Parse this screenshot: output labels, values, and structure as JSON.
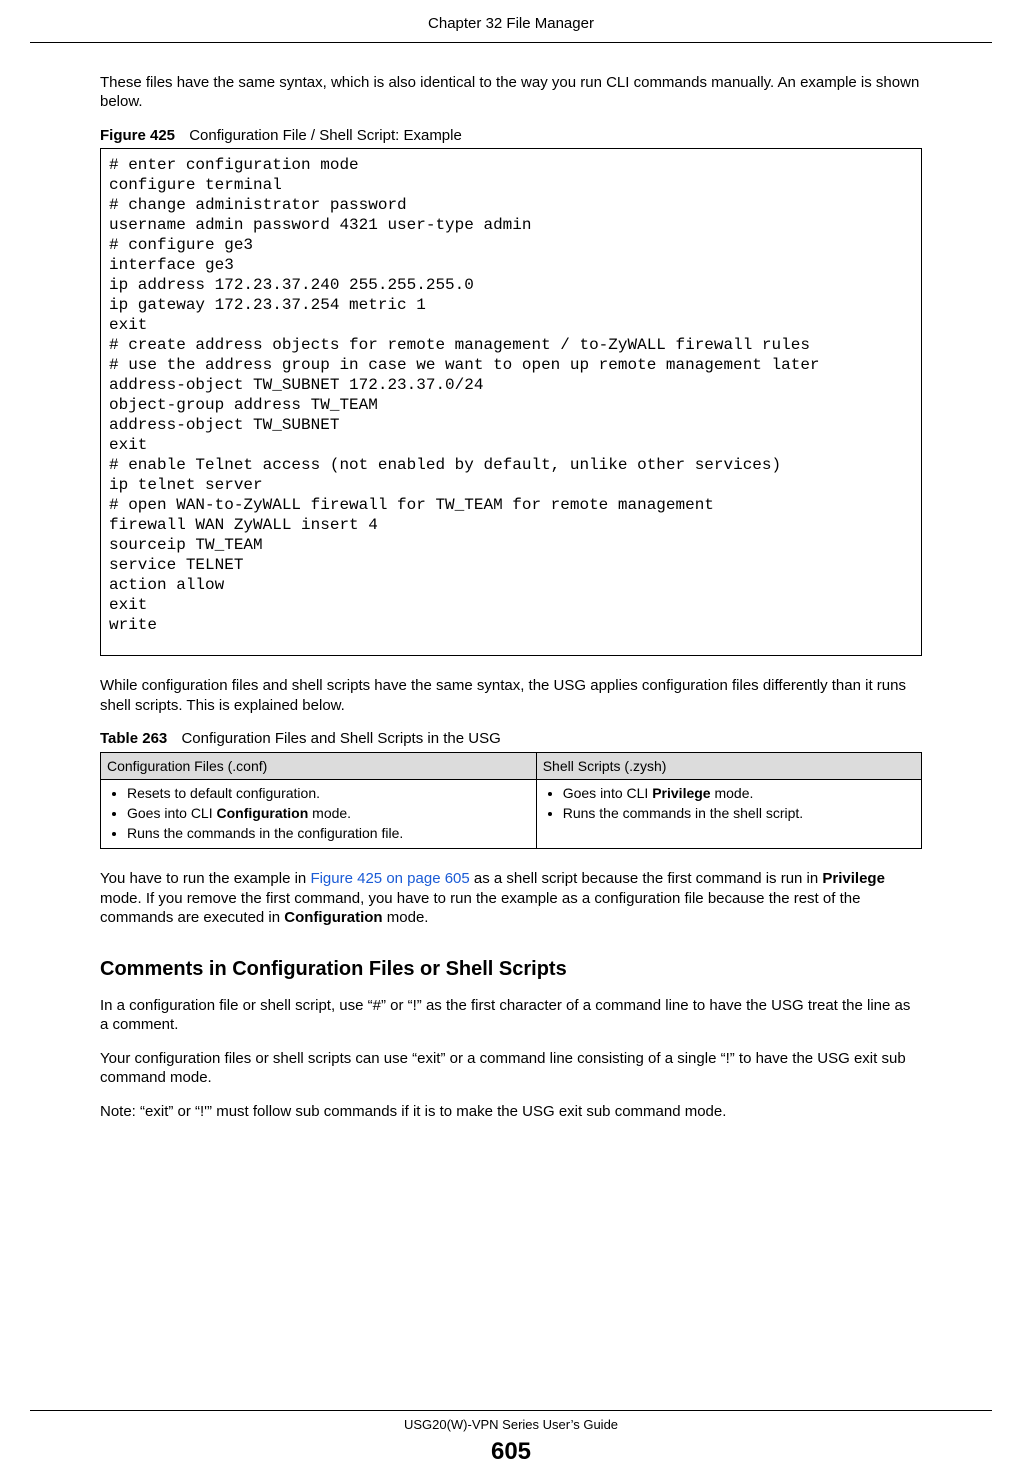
{
  "header": "Chapter 32 File Manager",
  "intro": "These files have the same syntax, which is also identical to the way you run CLI commands manually. An example is shown below.",
  "figure": {
    "label": "Figure 425",
    "caption": "Configuration File / Shell Script: Example",
    "code": "# enter configuration mode\nconfigure terminal\n# change administrator password\nusername admin password 4321 user-type admin\n# configure ge3\ninterface ge3\nip address 172.23.37.240 255.255.255.0\nip gateway 172.23.37.254 metric 1\nexit\n# create address objects for remote management / to-ZyWALL firewall rules\n# use the address group in case we want to open up remote management later\naddress-object TW_SUBNET 172.23.37.0/24\nobject-group address TW_TEAM\naddress-object TW_SUBNET\nexit\n# enable Telnet access (not enabled by default, unlike other services)\nip telnet server\n# open WAN-to-ZyWALL firewall for TW_TEAM for remote management\nfirewall WAN ZyWALL insert 4\nsourceip TW_TEAM\nservice TELNET\naction allow\nexit\nwrite"
  },
  "after_figure": "While configuration files and shell scripts have the same syntax, the USG applies configuration files differently than it runs shell scripts. This is explained below.",
  "table": {
    "label": "Table 263",
    "caption": "Configuration Files and Shell Scripts in the USG",
    "headers": [
      "Configuration Files (.conf)",
      "Shell Scripts (.zysh)"
    ],
    "col1": {
      "b1": "Resets to default configuration.",
      "b2a": "Goes into CLI ",
      "b2b": "Configuration",
      "b2c": " mode.",
      "b3": "Runs the commands in the configuration file."
    },
    "col2": {
      "b1a": "Goes into CLI ",
      "b1b": "Privilege",
      "b1c": " mode.",
      "b2": "Runs the commands in the shell script."
    }
  },
  "after_table": {
    "p1a": "You have to run the example in ",
    "p1link": "Figure 425 on page 605",
    "p1b": " as a shell script because the first command is run in ",
    "p1bold1": "Privilege",
    "p1c": " mode. If you remove the first command, you have to run the example as a configuration file because the rest of the commands are executed in ",
    "p1bold2": "Configuration",
    "p1d": " mode."
  },
  "section_heading": "Comments in Configuration Files or Shell Scripts",
  "p2": "In a configuration file or shell script, use “#” or “!” as the first character of a command line to have the USG treat the line as a comment.",
  "p3": "Your configuration files or shell scripts can use “exit” or a command line consisting of a single “!” to have the USG exit sub command mode.",
  "note": "Note: “exit” or “!'” must follow sub commands if it is to make the USG exit sub command mode.",
  "footer": "USG20(W)-VPN Series User’s Guide",
  "page_number": "605"
}
